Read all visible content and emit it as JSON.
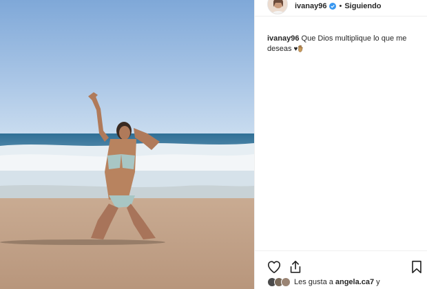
{
  "post": {
    "author": {
      "username": "ivanay96",
      "verified": true,
      "verified_icon": "verified-badge-icon",
      "separator": "•",
      "follow_status": "Siguiendo"
    },
    "caption": {
      "username": "ivanay96",
      "text": "Que Dios multiplique lo que me deseas",
      "emoji_1": "♥",
      "emoji_2_icon": "raised-hand-emoji-icon"
    },
    "actions": {
      "like_icon": "heart-icon",
      "share_icon": "share-icon",
      "save_icon": "bookmark-icon"
    },
    "likes": {
      "prefix": "Les gusta a",
      "first_liker": "angela.ca7",
      "suffix": "y"
    },
    "colors": {
      "text": "#262626",
      "border": "#efefef",
      "verified_blue": "#3897f0"
    }
  }
}
